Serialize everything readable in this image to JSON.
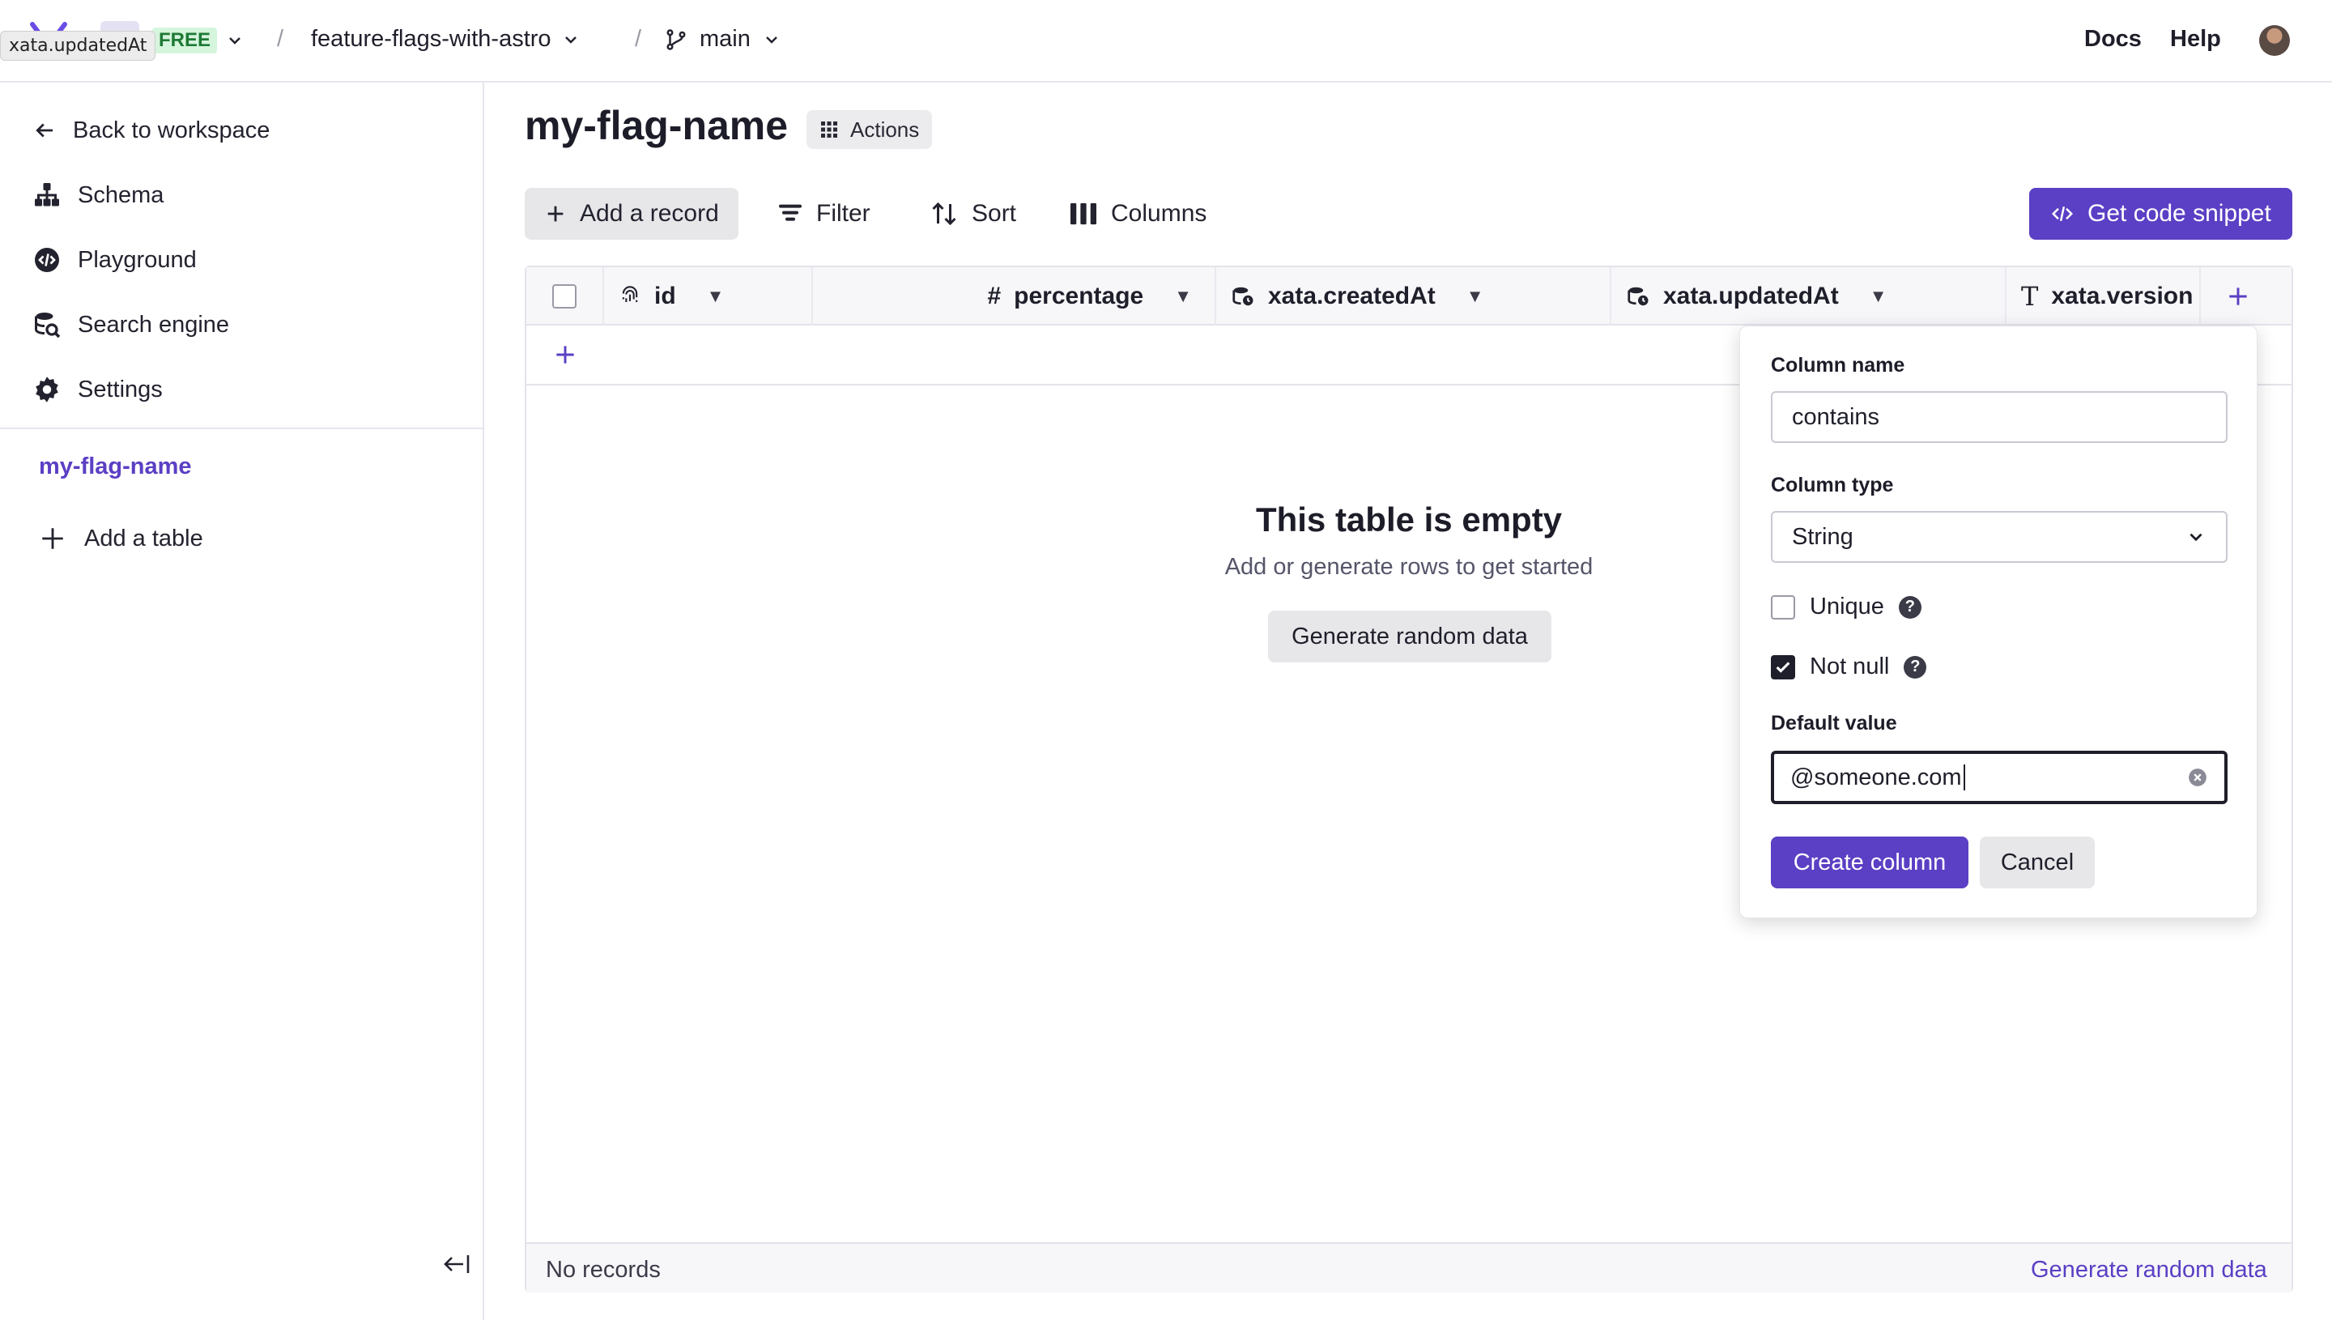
{
  "topbar": {
    "plan_badge": "FREE",
    "database": "feature-flags-with-astro",
    "branch": "main",
    "separator": "/",
    "docs": "Docs",
    "help": "Help",
    "tooltip": "xata.updatedAt"
  },
  "sidebar": {
    "back": "Back to workspace",
    "items": [
      {
        "label": "Schema",
        "icon": "schema-icon"
      },
      {
        "label": "Playground",
        "icon": "playground-icon"
      },
      {
        "label": "Search engine",
        "icon": "search-engine-icon"
      },
      {
        "label": "Settings",
        "icon": "gear-icon"
      }
    ],
    "tables": [
      "my-flag-name"
    ],
    "add_table": "Add a table"
  },
  "main": {
    "title": "my-flag-name",
    "actions": "Actions",
    "toolbar": {
      "add_record": "Add a record",
      "filter": "Filter",
      "sort": "Sort",
      "columns": "Columns",
      "code_snippet": "Get code snippet"
    },
    "columns": [
      {
        "label": "id",
        "icon": "fingerprint-icon"
      },
      {
        "label": "percentage",
        "icon": "hash-icon"
      },
      {
        "label": "xata.createdAt",
        "icon": "datetime-icon"
      },
      {
        "label": "xata.updatedAt",
        "icon": "datetime-icon"
      },
      {
        "label": "xata.version",
        "icon": "text-icon"
      }
    ],
    "empty": {
      "title": "This table is empty",
      "subtitle": "Add or generate rows to get started",
      "button": "Generate random data"
    },
    "footer": {
      "status": "No records",
      "generate": "Generate random data"
    }
  },
  "popover": {
    "column_name_label": "Column name",
    "column_name_value": "contains",
    "column_type_label": "Column type",
    "column_type_value": "String",
    "unique_label": "Unique",
    "unique_checked": false,
    "not_null_label": "Not null",
    "not_null_checked": true,
    "default_value_label": "Default value",
    "default_value": "@someone.com",
    "create": "Create column",
    "cancel": "Cancel"
  },
  "colors": {
    "accent": "#5b3fc4",
    "free_badge_bg": "#d6f5dd",
    "free_badge_text": "#1e7a35"
  }
}
